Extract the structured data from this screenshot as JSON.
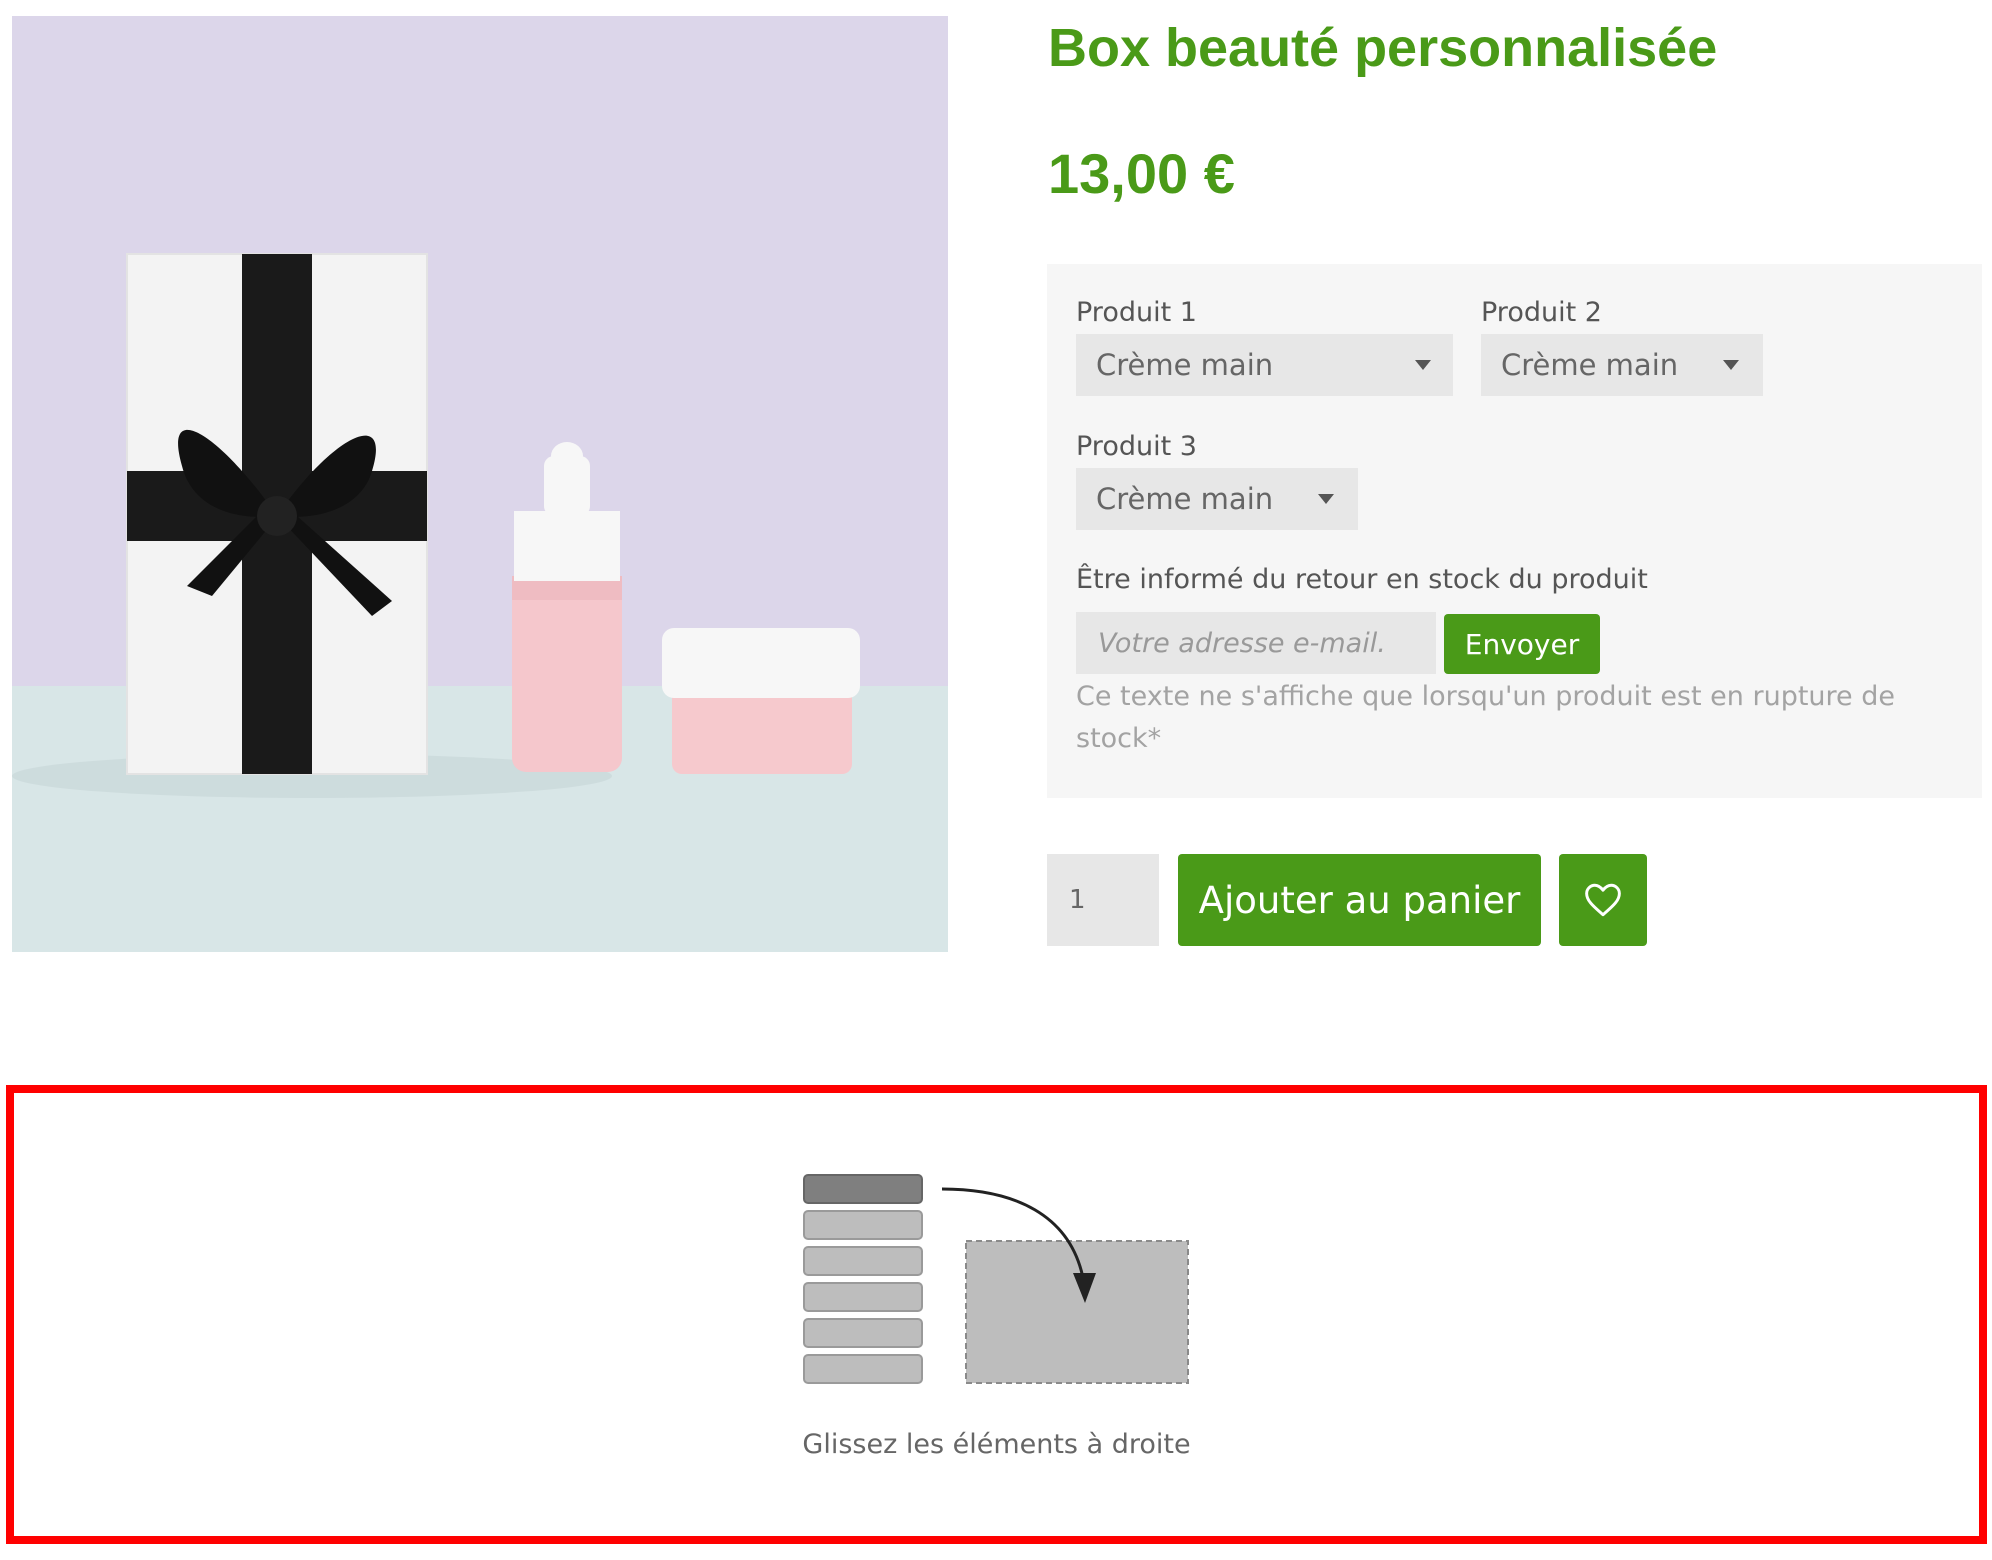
{
  "product": {
    "title": "Box beauté personnalisée",
    "price": "13,00 €",
    "image_alt": "gift-box-with-black-ribbon-and-pink-cosmetics"
  },
  "options": {
    "product1": {
      "label": "Produit 1",
      "value": "Crème main"
    },
    "product2": {
      "label": "Produit 2",
      "value": "Crème main"
    },
    "product3": {
      "label": "Produit 3",
      "value": "Crème main"
    }
  },
  "stock_alert": {
    "label": "Être informé du retour en stock du produit",
    "email_placeholder": "Votre adresse e-mail.",
    "send_label": "Envoyer",
    "note": "Ce texte ne s'affiche que lorsqu'un produit est en rupture de stock*"
  },
  "purchase": {
    "quantity": "1",
    "add_to_cart_label": "Ajouter au panier",
    "wishlist_icon": "heart-icon"
  },
  "drop_zone": {
    "caption": "Glissez les éléments à droite",
    "border_color": "#ff0000"
  },
  "colors": {
    "accent": "#4a9a18",
    "panel_bg": "#f6f6f6",
    "field_bg": "#e7e7e7"
  }
}
